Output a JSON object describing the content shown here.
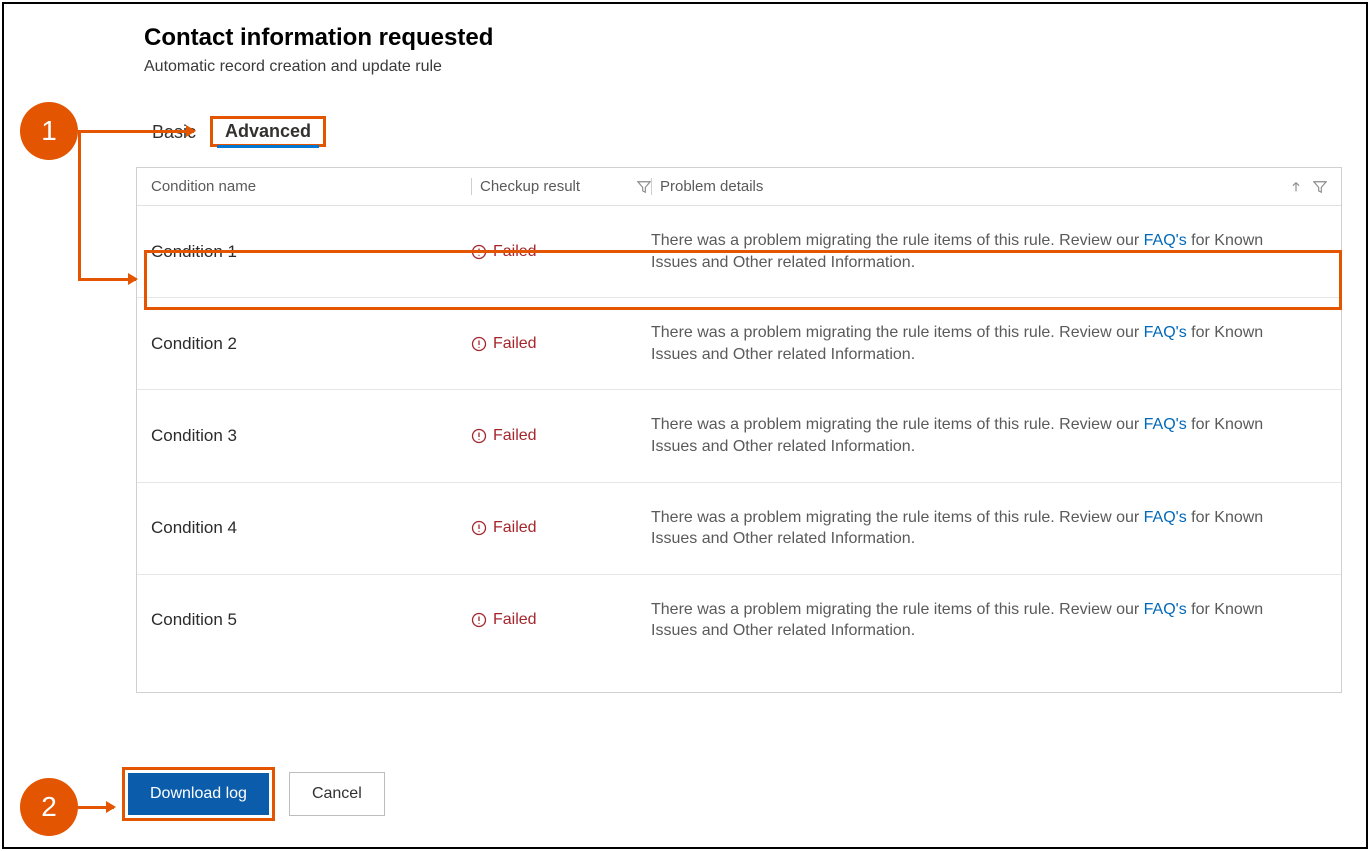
{
  "header": {
    "title": "Contact information requested",
    "subtitle": "Automatic record creation and update rule"
  },
  "tabs": {
    "basic": "Basic",
    "advanced": "Advanced"
  },
  "table": {
    "columns": {
      "condition_name": "Condition name",
      "checkup_result": "Checkup result",
      "problem_details": "Problem details"
    },
    "rows": [
      {
        "name": "Condition 1",
        "result": "Failed",
        "details_pre": "There was a problem migrating the rule items of this rule. Review our ",
        "faq_link": "FAQ's",
        "details_post": " for Known Issues and Other related Information."
      },
      {
        "name": "Condition 2",
        "result": "Failed",
        "details_pre": "There was a problem migrating the rule items of this rule. Review our ",
        "faq_link": "FAQ's",
        "details_post": " for Known Issues and Other related Information."
      },
      {
        "name": "Condition 3",
        "result": "Failed",
        "details_pre": "There was a problem migrating the rule items of this rule. Review our ",
        "faq_link": "FAQ's",
        "details_post": " for Known Issues and Other related Information."
      },
      {
        "name": "Condition 4",
        "result": "Failed",
        "details_pre": "There was a problem migrating the rule items of this rule. Review our ",
        "faq_link": "FAQ's",
        "details_post": " for Known Issues and Other related Information."
      },
      {
        "name": "Condition 5",
        "result": "Failed",
        "details_pre": "There was a problem migrating the rule items of this rule. Review our ",
        "faq_link": "FAQ's",
        "details_post": " for Known Issues and Other related Information."
      }
    ]
  },
  "footer": {
    "download_label": "Download log",
    "cancel_label": "Cancel"
  },
  "callouts": {
    "one": "1",
    "two": "2"
  }
}
